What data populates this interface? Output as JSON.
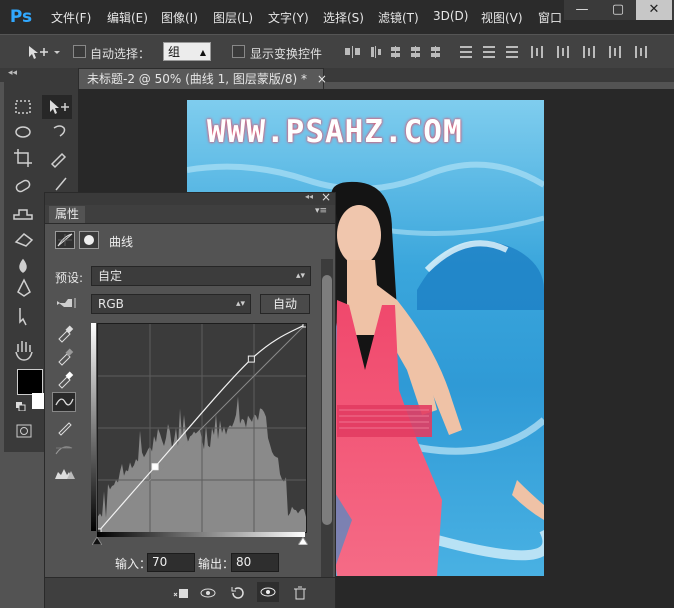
{
  "app": {
    "logo": "Ps"
  },
  "menu": [
    "文件(F)",
    "编辑(E)",
    "图像(I)",
    "图层(L)",
    "文字(Y)",
    "选择(S)",
    "滤镜(T)",
    "3D(D)",
    "视图(V)",
    "窗口"
  ],
  "window_controls": {
    "minimize": "—",
    "maximize": "▢",
    "close": "✕"
  },
  "options": {
    "auto_select_label": "自动选择：",
    "group_value": "组",
    "show_transform_label": "显示变换控件"
  },
  "toolbar": {
    "collapse_glyph": "◂◂"
  },
  "document": {
    "tab_title": "未标题-2 @ 50% (曲线 1, 图层蒙版/8) *",
    "tab_close": "×"
  },
  "photo": {
    "watermark": "WWW.PSAHZ.COM"
  },
  "properties": {
    "tab_label": "属性",
    "panel_menu_glyph": "▾≡",
    "collapse_glyph": "◂◂",
    "close_glyph": "×",
    "adjustment_title": "曲线",
    "preset_label": "预设:",
    "preset_value": "自定",
    "channel_value": "RGB",
    "auto_button": "自动",
    "input_label": "输入：",
    "input_value": "70",
    "output_label": "输出：",
    "output_value": "80"
  },
  "curve": {
    "points": [
      [
        0,
        0
      ],
      [
        70,
        80
      ],
      [
        188,
        212
      ],
      [
        255,
        255
      ]
    ]
  },
  "colors": {
    "foreground": "#000000",
    "background": "#ffffff",
    "accent": "#31a8ff"
  }
}
